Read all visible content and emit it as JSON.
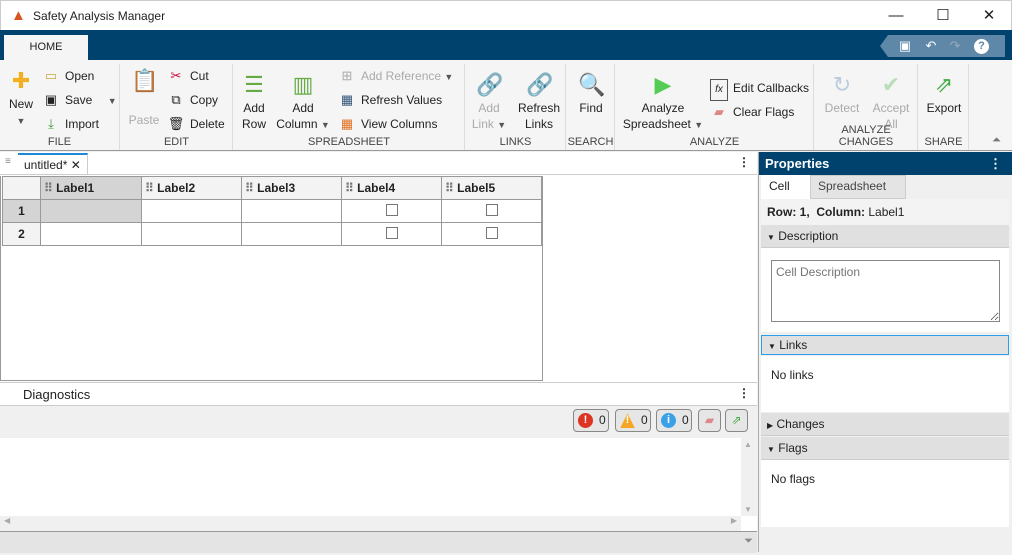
{
  "window": {
    "title": "Safety Analysis Manager",
    "minimize": "—",
    "maximize": "☐",
    "close": "✕"
  },
  "ribbon": {
    "tab": "HOME",
    "groups": {
      "file": "FILE",
      "edit": "EDIT",
      "spreadsheet": "SPREADSHEET",
      "links": "LINKS",
      "search": "SEARCH",
      "analyze": "ANALYZE",
      "analyze_changes": "ANALYZE CHANGES",
      "share": "SHARE"
    },
    "new": "New",
    "open": "Open",
    "save": "Save",
    "import": "Import",
    "paste": "Paste",
    "cut": "Cut",
    "copy": "Copy",
    "delete": "Delete",
    "add_row_1": "Add",
    "add_row_2": "Row",
    "add_col_1": "Add",
    "add_col_2": "Column",
    "add_reference": "Add Reference",
    "refresh_values": "Refresh Values",
    "view_columns": "View Columns",
    "add_link_1": "Add",
    "add_link_2": "Link",
    "refresh_links_1": "Refresh",
    "refresh_links_2": "Links",
    "find": "Find",
    "analyze_1": "Analyze",
    "analyze_2": "Spreadsheet",
    "edit_callbacks": "Edit Callbacks",
    "clear_flags": "Clear Flags",
    "detect": "Detect",
    "accept_1": "Accept",
    "accept_2": "All",
    "export": "Export"
  },
  "document": {
    "tab": "untitled*"
  },
  "table": {
    "columns": [
      "Label1",
      "Label2",
      "Label3",
      "Label4",
      "Label5"
    ],
    "rows": [
      "1",
      "2"
    ]
  },
  "diagnostics": {
    "title": "Diagnostics",
    "errors": "0",
    "warnings": "0",
    "info": "0"
  },
  "properties": {
    "title": "Properties",
    "tabs": [
      "Cell",
      "Spreadsheet"
    ],
    "row_label": "Row:",
    "row": "1,",
    "col_label": "Column:",
    "col": "Label1",
    "description": "Description",
    "description_placeholder": "Cell Description",
    "links": "Links",
    "links_body": "No links",
    "changes": "Changes",
    "flags": "Flags",
    "flags_body": "No flags"
  },
  "colors": {
    "accent": "#00426e",
    "tab_underline": "#1e88d8"
  }
}
